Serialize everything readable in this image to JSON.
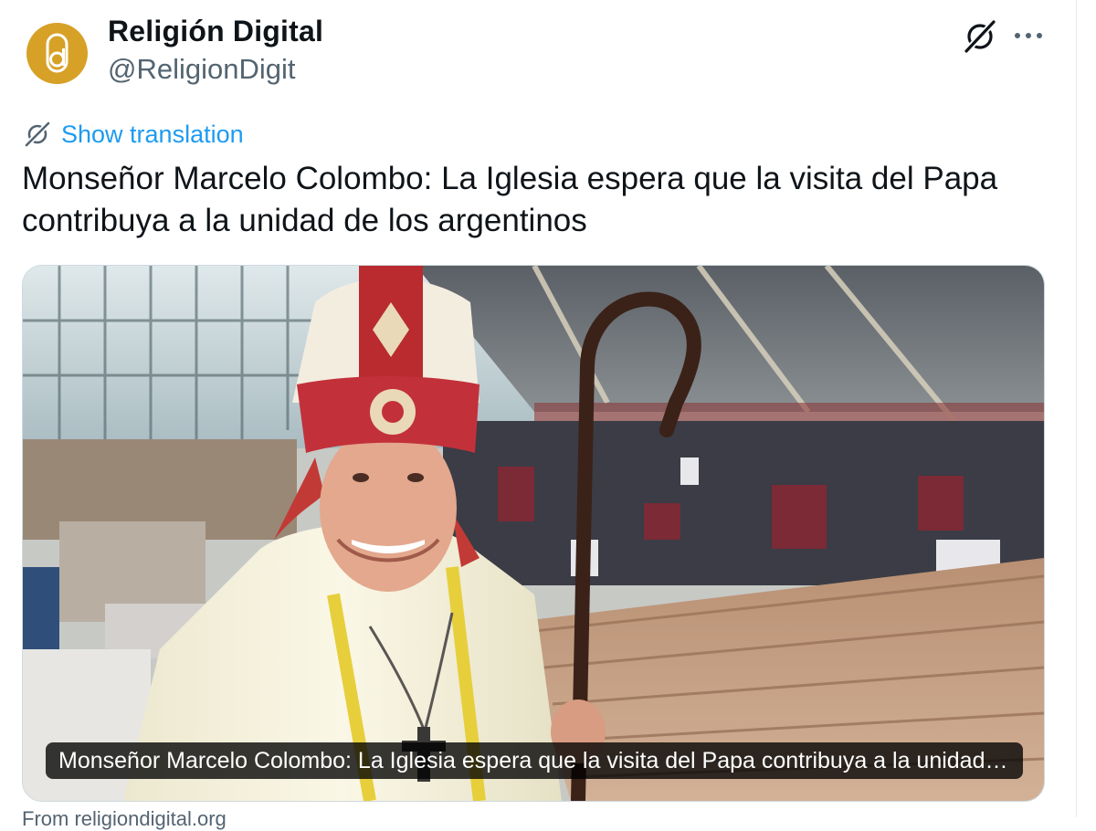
{
  "author": {
    "display_name": "Religión Digital",
    "handle": "@ReligionDigit",
    "avatar_icon": "religion-digital-logo-icon",
    "avatar_color": "#d6a126"
  },
  "header_actions": {
    "grok_icon": "grok-icon",
    "more_icon": "more-horizontal-icon"
  },
  "translation": {
    "icon": "grok-icon",
    "label": "Show translation",
    "color": "#1d9bf0"
  },
  "tweet": {
    "text": "Monseñor Marcelo Colombo: La Iglesia espera que la visita del Papa contribuya a la unidad de los argentinos"
  },
  "media_card": {
    "caption": "Monseñor Marcelo Colombo: La Iglesia espera que la visita del Papa contribuya a la unidad de los argentinos"
  },
  "link_source": {
    "text": "From religiondigital.org"
  },
  "colors": {
    "text_primary": "#0f1419",
    "text_secondary": "#536471",
    "link": "#1d9bf0",
    "border": "#cfd9de"
  }
}
